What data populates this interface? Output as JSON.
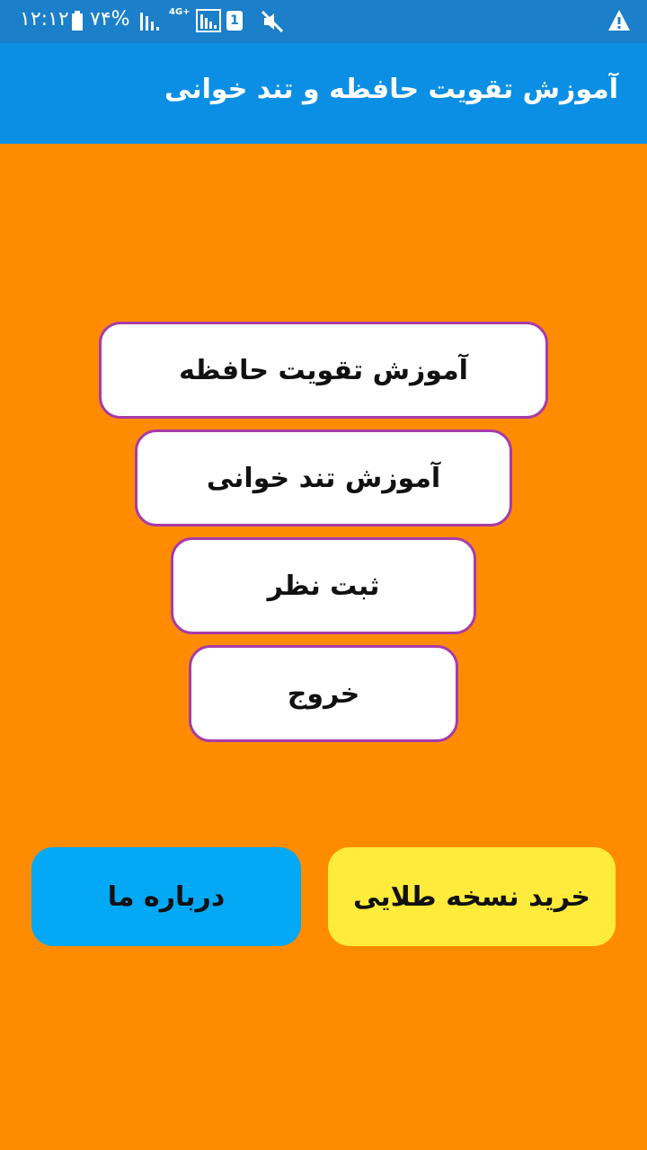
{
  "status_bar": {
    "time": "۱۲:۱۲",
    "battery": "۷۴%",
    "network": "4G+",
    "sim_slot": "1",
    "icons": [
      "battery-icon",
      "signal-icon",
      "signal-icon",
      "sim-icon",
      "mute-icon",
      "warning-icon"
    ]
  },
  "app_bar": {
    "title": "آموزش تقویت حافظه و تند خوانی",
    "color": "#0B8FE4"
  },
  "menu": {
    "items": [
      {
        "label": "آموزش تقویت حافظه"
      },
      {
        "label": "آموزش تند خوانی"
      },
      {
        "label": "ثبت نظر"
      },
      {
        "label": "خروج"
      }
    ],
    "border_color": "#A83BA8"
  },
  "bottom": {
    "about_label": "درباره ما",
    "gold_label": "خرید نسخه طلایی",
    "about_color": "#03A9F4",
    "gold_color": "#FFEB3B"
  },
  "background_color": "#FF8C00"
}
